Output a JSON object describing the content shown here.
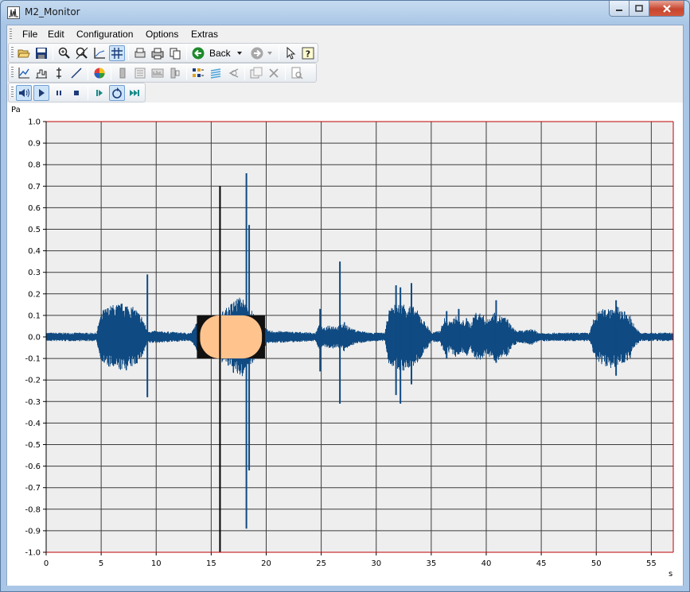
{
  "window": {
    "title": "M2_Monitor"
  },
  "menu": {
    "items": [
      {
        "id": "file",
        "label": "File"
      },
      {
        "id": "edit",
        "label": "Edit"
      },
      {
        "id": "configuration",
        "label": "Configuration"
      },
      {
        "id": "options",
        "label": "Options"
      },
      {
        "id": "extras",
        "label": "Extras"
      }
    ]
  },
  "toolbar": {
    "back_label": "Back",
    "row1_icons": [
      "open-folder-icon",
      "save-icon",
      "zoom-in-icon",
      "zoom-reset-icon",
      "axis-scale-icon",
      "grid-icon",
      "print-preview-icon",
      "print-icon",
      "copy-icon",
      "back-arrow-icon",
      "forward-arrow-icon",
      "pointer-icon",
      "help-icon"
    ],
    "row2_icons": [
      "line-graph-icon",
      "histogram-icon",
      "cursor-icon",
      "diagonal-line-icon",
      "color-wheel-icon",
      "channel-icon",
      "list-icon",
      "spectrum-icon",
      "split-icon",
      "multi-plot-icon",
      "layers-icon",
      "fft-icon",
      "copy-plot-icon",
      "delete-icon",
      "page-settings-icon"
    ],
    "row3_icons": [
      "speaker-icon",
      "play-icon",
      "pause-icon",
      "stop-icon",
      "step-forward-icon",
      "loop-icon",
      "skip-end-icon"
    ],
    "pressed": [
      "grid-icon",
      "speaker-icon",
      "play-icon",
      "loop-icon"
    ]
  },
  "colors": {
    "plot_bg": "#eeeeee",
    "grid": "#3c3c3c",
    "signal": "#0f4a82",
    "selection": "#ffc38e",
    "cursor": "#000000",
    "axis_frame": "#c00000"
  },
  "chart_data": {
    "type": "line",
    "ylabel": "Pa",
    "xlabel": "s",
    "xlim": [
      0,
      57
    ],
    "ylim": [
      -1.0,
      1.0
    ],
    "x_ticks": [
      "0",
      "5",
      "10",
      "15",
      "20",
      "25",
      "30",
      "35",
      "40",
      "45",
      "50",
      "55"
    ],
    "y_ticks": [
      "1.0",
      "0.9",
      "0.8",
      "0.7",
      "0.6",
      "0.5",
      "0.4",
      "0.3",
      "0.2",
      "0.1",
      "0.0",
      "-0.1",
      "-0.2",
      "-0.3",
      "-0.4",
      "-0.5",
      "-0.6",
      "-0.7",
      "-0.8",
      "-0.9",
      "-1.0"
    ],
    "grid": true,
    "series": [
      {
        "envelope": [
          [
            0,
            0.02
          ],
          [
            4.6,
            0.02
          ],
          [
            4.8,
            0.08
          ],
          [
            5.2,
            0.13
          ],
          [
            6,
            0.15
          ],
          [
            7.2,
            0.16
          ],
          [
            8.2,
            0.13
          ],
          [
            8.8,
            0.09
          ],
          [
            9.1,
            0.04
          ],
          [
            9.3,
            0.03
          ],
          [
            12.8,
            0.02
          ],
          [
            13.2,
            0.02
          ],
          [
            13.6,
            0.06
          ],
          [
            14.2,
            0.09
          ],
          [
            15.5,
            0.1
          ],
          [
            16.5,
            0.14
          ],
          [
            17.2,
            0.18
          ],
          [
            17.8,
            0.19
          ],
          [
            18.3,
            0.14
          ],
          [
            18.8,
            0.12
          ],
          [
            19.5,
            0.06
          ],
          [
            20.2,
            0.03
          ],
          [
            24.5,
            0.02
          ],
          [
            24.8,
            0.06
          ],
          [
            25.2,
            0.04
          ],
          [
            25.7,
            0.06
          ],
          [
            26.5,
            0.05
          ],
          [
            27.1,
            0.07
          ],
          [
            27.7,
            0.04
          ],
          [
            28.4,
            0.03
          ],
          [
            29.6,
            0.02
          ],
          [
            30.8,
            0.02
          ],
          [
            31.1,
            0.12
          ],
          [
            31.6,
            0.15
          ],
          [
            32.4,
            0.16
          ],
          [
            33.2,
            0.15
          ],
          [
            33.8,
            0.12
          ],
          [
            34.3,
            0.08
          ],
          [
            34.7,
            0.05
          ],
          [
            35.0,
            0.02
          ],
          [
            35.8,
            0.03
          ],
          [
            36.2,
            0.09
          ],
          [
            36.7,
            0.07
          ],
          [
            37.2,
            0.1
          ],
          [
            37.7,
            0.07
          ],
          [
            38.2,
            0.09
          ],
          [
            38.6,
            0.06
          ],
          [
            39.0,
            0.12
          ],
          [
            39.6,
            0.11
          ],
          [
            40.1,
            0.08
          ],
          [
            40.7,
            0.12
          ],
          [
            41.3,
            0.1
          ],
          [
            41.9,
            0.09
          ],
          [
            42.3,
            0.05
          ],
          [
            42.8,
            0.03
          ],
          [
            43.5,
            0.03
          ],
          [
            44.2,
            0.04
          ],
          [
            44.8,
            0.02
          ],
          [
            46.0,
            0.02
          ],
          [
            49.4,
            0.02
          ],
          [
            49.7,
            0.08
          ],
          [
            50.2,
            0.12
          ],
          [
            51.0,
            0.14
          ],
          [
            51.7,
            0.15
          ],
          [
            52.3,
            0.13
          ],
          [
            53.1,
            0.1
          ],
          [
            53.5,
            0.05
          ],
          [
            54.0,
            0.02
          ],
          [
            57,
            0.02
          ]
        ],
        "spikes": [
          [
            9.2,
            0.29,
            -0.28
          ],
          [
            18.2,
            0.76,
            -0.89
          ],
          [
            18.45,
            0.52,
            -0.62
          ],
          [
            24.9,
            0.13,
            -0.16
          ],
          [
            26.7,
            0.35,
            -0.31
          ],
          [
            31.8,
            0.24,
            -0.27
          ],
          [
            32.2,
            0.23,
            -0.31
          ],
          [
            33.2,
            0.25,
            -0.22
          ],
          [
            36.4,
            0.12,
            -0.1
          ],
          [
            37.5,
            0.13,
            -0.08
          ],
          [
            40.9,
            0.17,
            -0.12
          ],
          [
            51.8,
            0.17,
            -0.18
          ]
        ]
      }
    ],
    "selection": {
      "x_start": 13.7,
      "x_end": 19.9,
      "y_min": -0.1,
      "y_max": 0.1
    },
    "cursor_x": 15.8,
    "cursor_y_range": [
      -1.0,
      0.7
    ]
  }
}
